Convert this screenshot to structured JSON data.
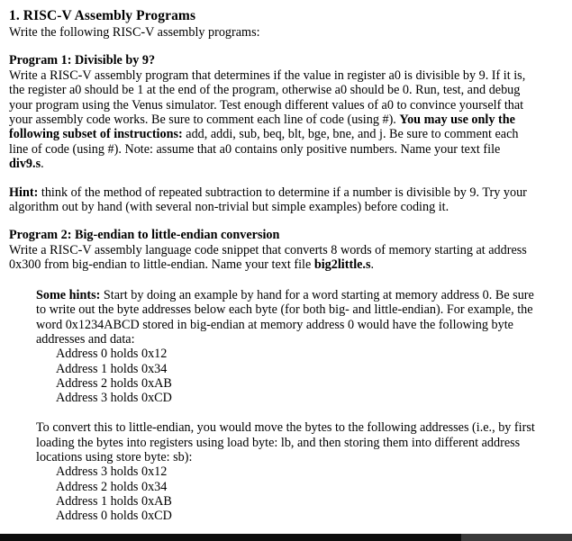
{
  "document": {
    "title": "1. RISC-V Assembly Programs",
    "intro": "Write the following RISC-V assembly programs:",
    "program1": {
      "heading": "Program 1: Divisible by 9?",
      "body_part1": "Write a RISC-V assembly program that determines if the value in register a0 is divisible by 9. If it is, the register a0 should be 1 at the end of the program, otherwise a0 should be 0. Run, test, and debug your program using the Venus simulator. Test enough different values of a0 to convince yourself that your assembly code works. Be sure to comment each line of code (using #). ",
      "body_bold": "You may use only the following subset of instructions:",
      "body_part2": " add, addi, sub, beq, blt, bge, bne, and j. Be sure to comment each line of code (using #). Note: assume that a0 contains only positive numbers. Name your text file ",
      "filename": "div9.s",
      "body_end": ".",
      "hint_label": "Hint:",
      "hint_text": " think of the method of repeated subtraction to determine if a number is divisible by 9. Try your algorithm out by hand (with several non-trivial but simple examples) before coding it."
    },
    "program2": {
      "heading": "Program 2: Big-endian to little-endian conversion",
      "body_part1": "Write a RISC-V assembly language code snippet that converts 8 words of memory starting at address 0x300 from big-endian to little-endian. Name your text file ",
      "filename": "big2little.s",
      "body_end": ".",
      "hints_label": "Some hints:",
      "hints_text": "  Start by doing an example by hand for a word starting at memory address 0. Be sure to write out the byte addresses below each byte (for both big- and little-endian). For example, the word 0x1234ABCD stored in big-endian at memory address 0 would have the following byte addresses and data:",
      "big_endian_list": [
        "Address 0 holds 0x12",
        "Address 1 holds 0x34",
        "Address 2 holds 0xAB",
        "Address 3 holds 0xCD"
      ],
      "convert_text": "To convert this to little-endian, you would move the bytes to the following addresses (i.e., by first loading the bytes into registers using load byte: lb, and then storing them into different address locations using store byte: sb):",
      "little_endian_list": [
        "Address 3 holds 0x12",
        "Address 2 holds 0x34",
        "Address 1 holds 0xAB",
        "Address 0 holds 0xCD"
      ]
    }
  },
  "scrollbar": {
    "orientation": "horizontal",
    "thumb_color": "#0d0d0d",
    "track_color": "#3a3a3a"
  }
}
